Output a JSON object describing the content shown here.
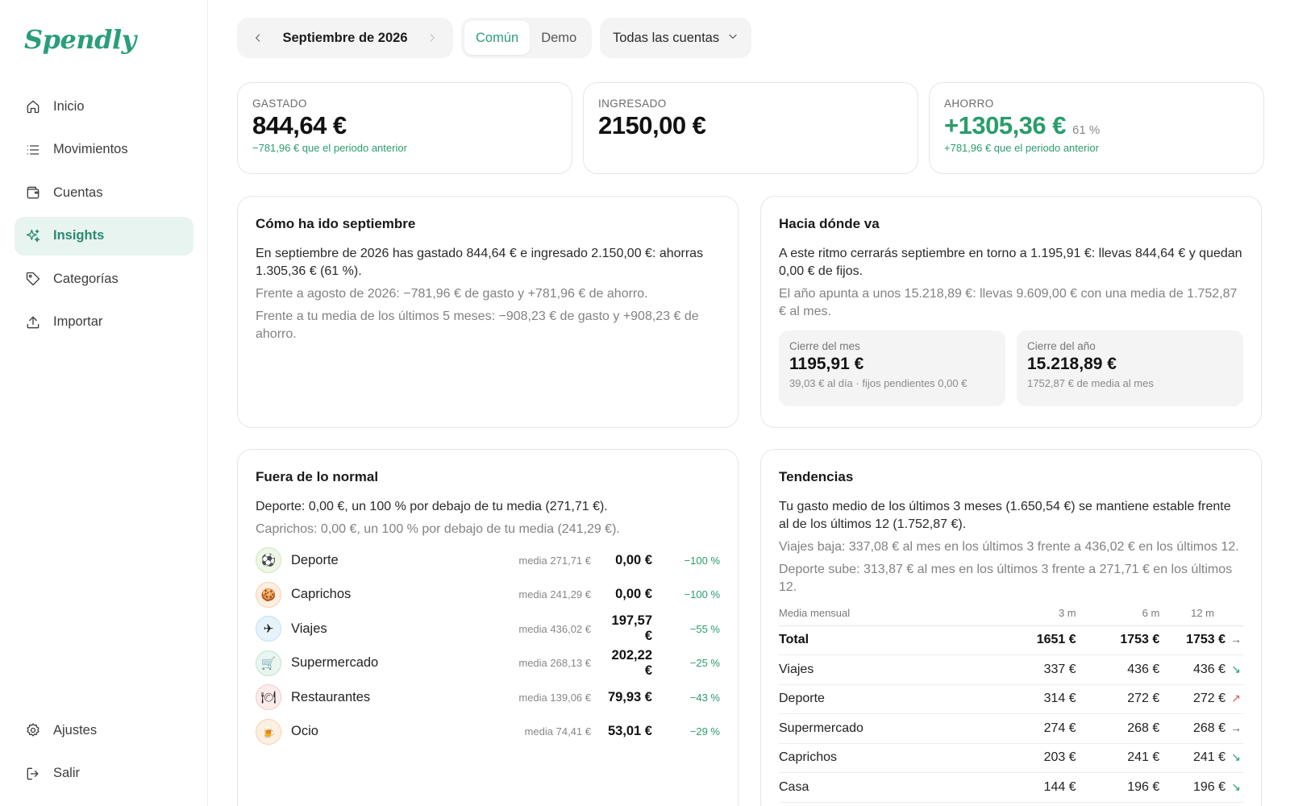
{
  "app": {
    "logo": "Spendly"
  },
  "sidebar": {
    "items": [
      {
        "label": "Inicio",
        "icon": "home-icon"
      },
      {
        "label": "Movimientos",
        "icon": "list-icon"
      },
      {
        "label": "Cuentas",
        "icon": "wallet-icon"
      },
      {
        "label": "Insights",
        "icon": "sparkles-icon",
        "active": true
      },
      {
        "label": "Categorías",
        "icon": "tag-icon"
      },
      {
        "label": "Importar",
        "icon": "upload-icon"
      }
    ],
    "bottom": [
      {
        "label": "Ajustes",
        "icon": "gear-icon"
      },
      {
        "label": "Salir",
        "icon": "logout-icon"
      }
    ]
  },
  "topbar": {
    "month": "Septiembre de 2026",
    "segments": [
      "Común",
      "Demo"
    ],
    "active_segment": "Común",
    "account_filter": "Todas las cuentas"
  },
  "stats": {
    "spent": {
      "label": "GASTADO",
      "value": "844,64 €",
      "sub": "−781,96 € que el periodo anterior"
    },
    "income": {
      "label": "INGRESADO",
      "value": "2150,00 €"
    },
    "savings": {
      "label": "AHORRO",
      "value": "+1305,36 €",
      "pct": "61 %",
      "sub": "+781,96 € que el periodo anterior"
    }
  },
  "summary": {
    "title": "Cómo ha ido septiembre",
    "main": "En septiembre de 2026 has gastado 844,64 € e ingresado 2.150,00 €: ahorras 1.305,36 € (61 %).",
    "line1": "Frente a agosto de 2026: −781,96 € de gasto y +781,96 € de ahorro.",
    "line2": "Frente a tu media de los últimos 5 meses: −908,23 € de gasto y +908,23 € de ahorro."
  },
  "forecast": {
    "title": "Hacia dónde va",
    "main": "A este ritmo cerrarás septiembre en torno a 1.195,91 €: llevas 844,64 € y quedan 0,00 € de fijos.",
    "line1": "El año apunta a unos 15.218,89 €: llevas 9.609,00 € con una media de 1.752,87 € al mes.",
    "month_close": {
      "label": "Cierre del mes",
      "value": "1195,91 €",
      "sub": "39,03 € al día · fijos pendientes 0,00 €"
    },
    "year_close": {
      "label": "Cierre del año",
      "value": "15.218,89 €",
      "sub": "1752,87 € de media al mes"
    }
  },
  "outliers": {
    "title": "Fuera de lo normal",
    "main": "Deporte: 0,00 €, un 100 % por debajo de tu media (271,71 €).",
    "line1": "Caprichos: 0,00 €, un 100 % por debajo de tu media (241,29 €).",
    "rows": [
      {
        "name": "Deporte",
        "emoji": "⚽",
        "avg": "media 271,71 €",
        "amount": "0,00 €",
        "delta": "−100 %",
        "bg": "#eef7e6",
        "border": "#cfe6b8"
      },
      {
        "name": "Caprichos",
        "emoji": "🍪",
        "avg": "media 241,29 €",
        "amount": "0,00 €",
        "delta": "−100 %",
        "bg": "#fdeee2",
        "border": "#f6cfae"
      },
      {
        "name": "Viajes",
        "emoji": "✈",
        "avg": "media 436,02 €",
        "amount": "197,57 €",
        "delta": "−55 %",
        "bg": "#e6f3fb",
        "border": "#bfe0f3"
      },
      {
        "name": "Supermercado",
        "emoji": "🛒",
        "avg": "media 268,13 €",
        "amount": "202,22 €",
        "delta": "−25 %",
        "bg": "#e8f6ef",
        "border": "#c1e6d2"
      },
      {
        "name": "Restaurantes",
        "emoji": "🍽",
        "avg": "media 139,06 €",
        "amount": "79,93 €",
        "delta": "−43 %",
        "bg": "#fdecec",
        "border": "#f4c8c8"
      },
      {
        "name": "Ocio",
        "emoji": "🍺",
        "avg": "media 74,41 €",
        "amount": "53,01 €",
        "delta": "−29 %",
        "bg": "#fdf0e2",
        "border": "#f5d2ad"
      }
    ]
  },
  "trends": {
    "title": "Tendencias",
    "main": "Tu gasto medio de los últimos 3 meses (1.650,54 €) se mantiene estable frente al de los últimos 12 (1.752,87 €).",
    "line1": "Viajes baja: 337,08 € al mes en los últimos 3 frente a 436,02 € en los últimos 12.",
    "line2": "Deporte sube: 313,87 € al mes en los últimos 3 frente a 271,71 € en los últimos 12.",
    "headers": [
      "Media mensual",
      "3 m",
      "6 m",
      "12 m"
    ],
    "rows": [
      {
        "name": "Total",
        "m3": "1651 €",
        "m6": "1753 €",
        "m12": "1753 €",
        "trend": "→",
        "color": "#555555",
        "total": true
      },
      {
        "name": "Viajes",
        "m3": "337 €",
        "m6": "436 €",
        "m12": "436 €",
        "trend": "↘",
        "color": "#2a9d6a"
      },
      {
        "name": "Deporte",
        "m3": "314 €",
        "m6": "272 €",
        "m12": "272 €",
        "trend": "↗",
        "color": "#e0584f"
      },
      {
        "name": "Supermercado",
        "m3": "274 €",
        "m6": "268 €",
        "m12": "268 €",
        "trend": "→",
        "color": "#555555"
      },
      {
        "name": "Caprichos",
        "m3": "203 €",
        "m6": "241 €",
        "m12": "241 €",
        "trend": "↘",
        "color": "#2a9d6a"
      },
      {
        "name": "Casa",
        "m3": "144 €",
        "m6": "196 €",
        "m12": "196 €",
        "trend": "↘",
        "color": "#2a9d6a"
      }
    ]
  },
  "colors": {
    "accent": "#2a9d7c",
    "positive": "#2a9d6a",
    "negative": "#e0584f"
  }
}
